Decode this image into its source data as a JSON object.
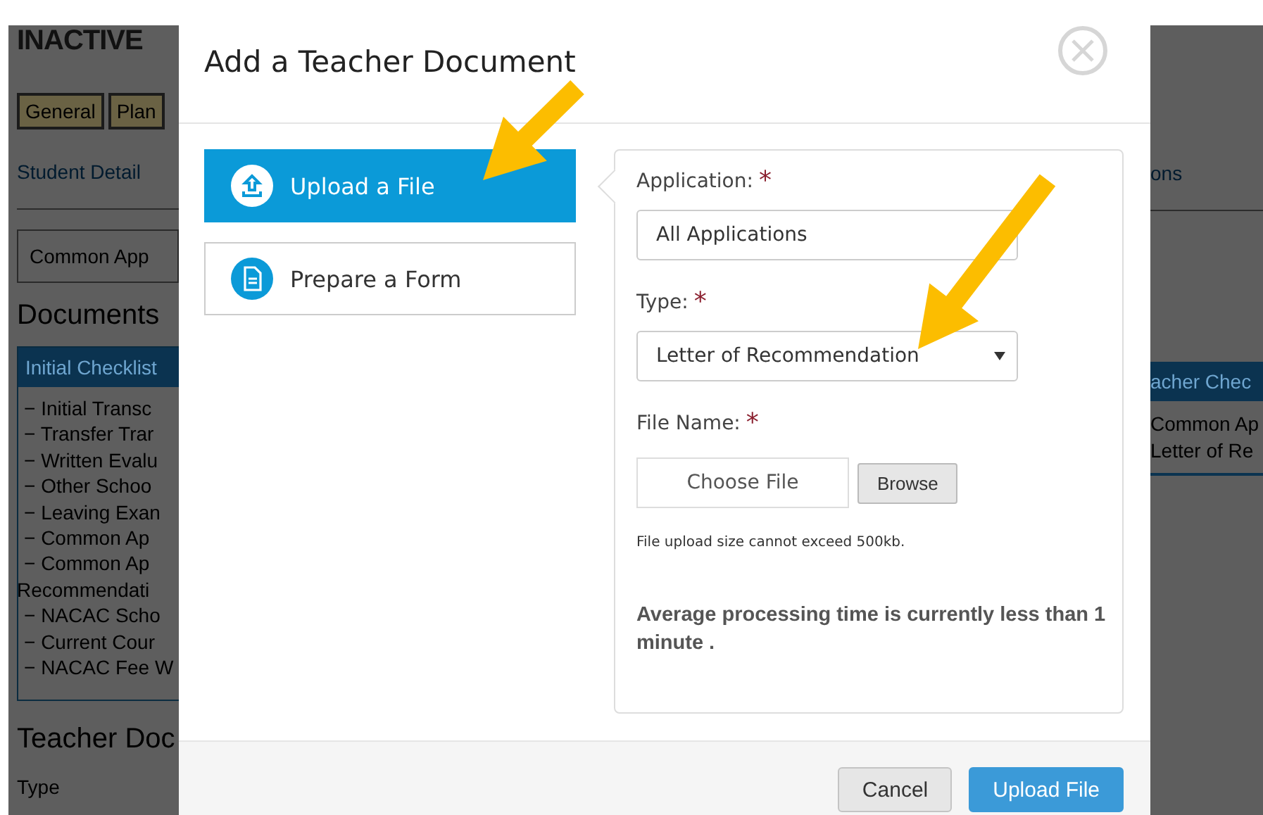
{
  "background_page": {
    "status": "INACTIVE",
    "tabs": [
      "General",
      "Plan"
    ],
    "subnav_left": "Student Detail",
    "subnav_right": "ons",
    "filter_value": "Common App",
    "documents_heading": "Documents",
    "initial_checklist": {
      "header": "Initial Checklist",
      "items": [
        {
          "text": "− Initial Transc",
          "kind": "item"
        },
        {
          "text": "− Transfer Trar",
          "kind": "item"
        },
        {
          "text": "− Written Evalu",
          "kind": "item"
        },
        {
          "text": "− Other Schoo",
          "kind": "item"
        },
        {
          "text": "− Leaving Exan",
          "kind": "item"
        },
        {
          "text": "− Common Ap",
          "kind": "item"
        },
        {
          "text": "− Common Ap",
          "kind": "item"
        },
        {
          "text": "Recommendati",
          "kind": "continuation"
        },
        {
          "text": "− NACAC Scho",
          "kind": "item"
        },
        {
          "text": "− Current Cour",
          "kind": "item"
        },
        {
          "text": "− NACAC Fee W",
          "kind": "item"
        }
      ]
    },
    "teacher_checklist": {
      "header": "acher Chec",
      "items": [
        "Common Ap",
        "Letter of Re"
      ]
    },
    "teacher_heading": "Teacher Doc",
    "table_column": "Type"
  },
  "modal": {
    "title": "Add a Teacher Document",
    "options": [
      {
        "label": "Upload a File",
        "selected": true
      },
      {
        "label": "Prepare a Form",
        "selected": false
      }
    ],
    "fields": [
      {
        "kind": "text",
        "label": "Application:",
        "required_mark": "*",
        "value": "All Applications"
      },
      {
        "kind": "select",
        "label": "Type:",
        "required_mark": "*",
        "value": "Letter of Recommendation"
      },
      {
        "kind": "file",
        "label": "File Name:",
        "required_mark": "*",
        "placeholder": "Choose File",
        "button": "Browse"
      }
    ],
    "size_note": "File upload size cannot exceed 500kb.",
    "processing_note": "Average processing time is currently less than 1 minute .",
    "buttons": [
      {
        "label": "Cancel",
        "kind": "secondary"
      },
      {
        "label": "Upload File",
        "kind": "primary"
      }
    ]
  }
}
